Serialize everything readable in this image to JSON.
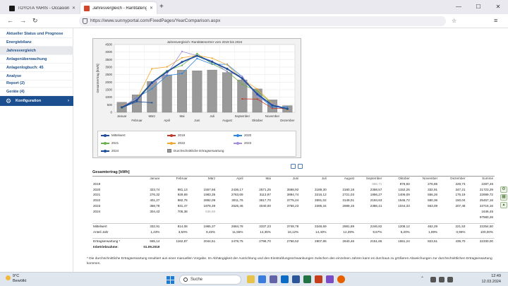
{
  "browser": {
    "tabs": [
      {
        "title": "TOYOTA YARIS - Occasionen ka",
        "favicon_color": "#1a1a1a"
      },
      {
        "title": "Jahresvergleich - Rantitätenglern",
        "favicon_color": "#d4462c"
      }
    ],
    "url": "https://www.sunnyportal.com/FixedPages/YearComparison.aspx",
    "new_tab_glyph": "+",
    "window_controls": [
      "—",
      "☐",
      "✕"
    ]
  },
  "sidebar": {
    "items": [
      {
        "label": "Aktueller Status und Prognose",
        "selected": false
      },
      {
        "label": "Energiebilanz",
        "selected": false
      },
      {
        "label": "Jahresvergleich",
        "selected": true
      },
      {
        "label": "Anlagenüberwachung",
        "selected": false
      },
      {
        "label": "Anlagenlogbuch: 45",
        "selected": false
      },
      {
        "label": "Analyse",
        "selected": false
      },
      {
        "label": "Report (2)",
        "selected": false
      },
      {
        "label": "Geräte (4)",
        "selected": false
      }
    ],
    "config": {
      "label": "Konfiguration",
      "icon": "gear-icon",
      "arrow": "›"
    }
  },
  "chart_data": {
    "type": "bar",
    "title": "Jahresvergleich: Rantitätenertrer vom 2019 bis 2024",
    "ylabel": "Gesamtertrag [kWh]",
    "ylim": [
      0,
      4500
    ],
    "yticks": [
      0,
      500,
      1000,
      1500,
      2000,
      2500,
      3000,
      3500,
      4000,
      4500
    ],
    "grid": true,
    "categories": [
      "Januar",
      "Februar",
      "März",
      "April",
      "Mai",
      "Juni",
      "Juli",
      "August",
      "September",
      "Oktober",
      "November",
      "Dezember"
    ],
    "x_tick_labels_upper": [
      "Januar",
      "",
      "März",
      "",
      "Mai",
      "",
      "Juli",
      "",
      "September",
      "",
      "November",
      ""
    ],
    "x_tick_labels_lower": [
      "",
      "Februar",
      "",
      "April",
      "",
      "Juni",
      "",
      "August",
      "",
      "Oktober",
      "",
      "Dezember"
    ],
    "bars": {
      "name": "Durchschnittliche Ertragserwartung",
      "values": [
        665.14,
        1162.87,
        2044.51,
        2479.75,
        2796.7,
        2756.52,
        2807.86,
        2640.46,
        2151.65,
        1551.24,
        823.61,
        439.7
      ],
      "color": "#9a9a9a"
    },
    "series": [
      {
        "name": "2019",
        "color": "#c0392b",
        "values": [
          null,
          null,
          null,
          null,
          null,
          null,
          null,
          null,
          886.71,
          876.93,
          276.85,
          229.73
        ]
      },
      {
        "name": "2020",
        "color": "#2e86de",
        "values": [
          323.74,
          981.13,
          1557.66,
          2436.17,
          2571.25,
          3568.92,
          3189.3,
          3180.18,
          2358.57,
          1152.26,
          332.91,
          347.21
        ]
      },
      {
        "name": "2021",
        "color": "#6ab04c",
        "values": [
          276.32,
          929.69,
          1983.35,
          2763.69,
          3113.97,
          3894.74,
          3216.12,
          2721.03,
          1856.27,
          1406.09,
          556.26,
          175.19
        ]
      },
      {
        "name": "2022",
        "color": "#f0a830",
        "values": [
          401.27,
          882.75,
          2892.09,
          3011.76,
          3617.7,
          3775.24,
          3591.02,
          3149.01,
          2194.63,
          1545.72,
          580.36,
          150.04
        ]
      },
      {
        "name": "2023",
        "color": "#a58fd8",
        "values": [
          358.79,
          931.47,
          1878.39,
          2525.46,
          4040.0,
          3756.23,
          3395.34,
          2689.15,
          2386.41,
          1044.33,
          563.09,
          207.48
        ]
      },
      {
        "name": "2024",
        "color": "#1f4e9a",
        "values": [
          304.43,
          705.38,
          636.69,
          null,
          null,
          null,
          null,
          null,
          null,
          null,
          null,
          null
        ]
      },
      {
        "name": "Mittelwert",
        "color": "#1f4e9a",
        "values": [
          332.91,
          814.08,
          1965.37,
          2684.78,
          3337.23,
          3748.78,
          3348.69,
          2881.89,
          2246.82,
          1208.12,
          462.29,
          221.53
        ]
      }
    ],
    "legend": [
      {
        "name": "Mittelwert",
        "kind": "line",
        "color": "#1f4e9a"
      },
      {
        "name": "2019",
        "kind": "line",
        "color": "#c0392b"
      },
      {
        "name": "2020",
        "kind": "line",
        "color": "#2e86de"
      },
      {
        "name": "2021",
        "kind": "line",
        "color": "#6ab04c"
      },
      {
        "name": "2022",
        "kind": "line",
        "color": "#f0a830"
      },
      {
        "name": "2023",
        "kind": "line",
        "color": "#a58fd8"
      },
      {
        "name": "2024",
        "kind": "line",
        "color": "#1f4e9a"
      },
      {
        "name": "Durchschnittliche Ertragserwartung",
        "kind": "bar",
        "color": "#9a9a9a"
      }
    ],
    "legend_placement": "bottom"
  },
  "table": {
    "title": "Gesamtertrag [kWh]",
    "columns": [
      "",
      "Januar",
      "Februar",
      "März",
      "April",
      "Mai",
      "Juni",
      "Juli",
      "August",
      "September",
      "Oktober",
      "November",
      "Dezember",
      "Summe"
    ],
    "rows": [
      {
        "label": "2019",
        "cells": [
          "",
          "",
          "",
          "",
          "",
          "",
          "",
          "",
          "886,71",
          "876,93",
          "276,85",
          "229,73",
          "2287,46"
        ],
        "grey": [
          false,
          false,
          false,
          false,
          false,
          false,
          false,
          false,
          true,
          false,
          false,
          false,
          false
        ]
      },
      {
        "label": "2020",
        "cells": [
          "323,74",
          "981,13",
          "1557,66",
          "2436,17",
          "2571,25",
          "3568,92",
          "3189,30",
          "3180,18",
          "2358,57",
          "1152,26",
          "332,91",
          "347,21",
          "21723,29"
        ]
      },
      {
        "label": "2021",
        "cells": [
          "276,32",
          "929,69",
          "1983,35",
          "2763,69",
          "3113,97",
          "3894,74",
          "3216,12",
          "2721,03",
          "1856,27",
          "1406,09",
          "556,26",
          "175,19",
          "22699,72"
        ]
      },
      {
        "label": "2022",
        "cells": [
          "401,27",
          "882,75",
          "2892,09",
          "3011,76",
          "3617,70",
          "3775,24",
          "3591,02",
          "3149,01",
          "2194,63",
          "1545,72",
          "580,36",
          "150,04",
          "25457,18"
        ]
      },
      {
        "label": "2023",
        "cells": [
          "358,79",
          "931,47",
          "1878,39",
          "2525,46",
          "4040,00",
          "3756,23",
          "3395,34",
          "2689,15",
          "2386,41",
          "1044,33",
          "563,09",
          "207,48",
          "23716,16"
        ]
      },
      {
        "label": "2024",
        "cells": [
          "304,43",
          "705,38",
          "636,69",
          "",
          "",
          "",
          "",
          "",
          "",
          "",
          "",
          "",
          "1646,45"
        ],
        "grey": [
          false,
          false,
          true,
          false,
          false,
          false,
          false,
          false,
          false,
          false,
          false,
          false,
          false
        ]
      },
      {
        "label": "",
        "cells": [
          "",
          "",
          "",
          "",
          "",
          "",
          "",
          "",
          "",
          "",
          "",
          "",
          "97580,28"
        ]
      }
    ],
    "summary": [
      {
        "label": "Mittelwert",
        "cells": [
          "332,91",
          "814,08",
          "1965,37",
          "2684,78",
          "3337,23",
          "3748,78",
          "3348,69",
          "2881,89",
          "2246,82",
          "1208,12",
          "462,29",
          "221,53",
          "22254,50"
        ]
      },
      {
        "label": "Anteil Jahr",
        "cells": [
          "1,43%",
          "3,50%",
          "8,45%",
          "11,55%",
          "14,35%",
          "16,12%",
          "14,40%",
          "12,39%",
          "9,67%",
          "5,20%",
          "1,99%",
          "0,95%",
          "100,00%"
        ]
      }
    ],
    "expectation": {
      "label": "Ertragserwartung *",
      "cells": [
        "665,14",
        "1162,87",
        "2044,51",
        "2479,75",
        "2796,70",
        "2756,52",
        "2807,86",
        "2640,46",
        "2151,65",
        "1551,24",
        "823,61",
        "439,70",
        "22330,00"
      ]
    },
    "commissioning": {
      "label": "Inbetriebnahme:",
      "value": "01.09.2019"
    }
  },
  "footnote": "* Die durchschnittliche Ertragserwartung resultiert aus einer manuellen Vorgabe. Im Abhängigkeit der Ausrichtung und den Einstrahlungsschwankungen zwischen den einzelnen Jahren kann es durchaus zu größeren Abweichungen zur durchschnittlichen Ertragserwartung kommen.",
  "taskbar": {
    "weather_temp": "9°C",
    "weather_text": "Bewölkt",
    "search_label": "Suche",
    "time": "12:49",
    "date": "12.03.2024"
  }
}
